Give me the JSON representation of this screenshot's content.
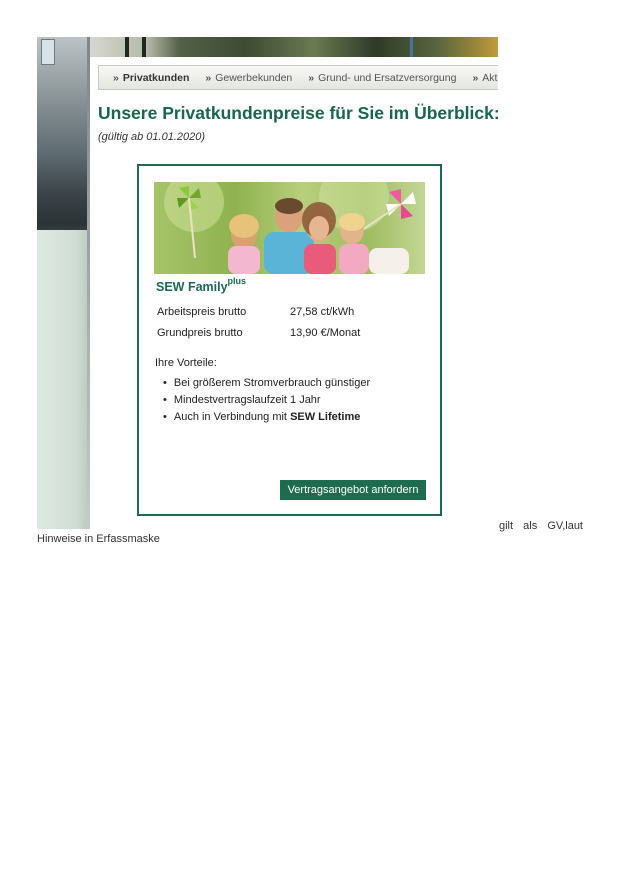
{
  "nav": {
    "items": [
      {
        "label": "Privatkunden",
        "active": true
      },
      {
        "label": "Gewerbekunden",
        "active": false
      },
      {
        "label": "Grund- und Ersatzversorgung",
        "active": false
      },
      {
        "label": "Aktion",
        "active": false
      }
    ],
    "prefix": "»"
  },
  "page": {
    "heading": "Unsere Privatkundenpreise für Sie im Überblick:",
    "validity": "(gültig ab 01.01.2020)"
  },
  "card": {
    "title": "SEW Family",
    "title_sup": "plus",
    "prices": [
      {
        "label": "Arbeitspreis brutto",
        "value": "27,58 ct/kWh"
      },
      {
        "label": "Grundpreis brutto",
        "value": "13,90 €/Monat"
      }
    ],
    "benefits_label": "Ihre Vorteile:",
    "benefits": [
      "Bei größerem Stromverbrauch günstiger",
      "Mindestvertragslaufzeit 1 Jahr"
    ],
    "benefit_last_prefix": "Auch in Verbindung mit",
    "benefit_last_bold": "SEW Lifetime",
    "bullet": "•",
    "cta_label": "Vertragsangebot anfordern",
    "colors": {
      "brand_green": "#1e6b4f",
      "border": "#21694e"
    }
  },
  "notes": {
    "line1": "gilt als GV,laut",
    "line2": "Hinweise in Erfassmaske"
  }
}
